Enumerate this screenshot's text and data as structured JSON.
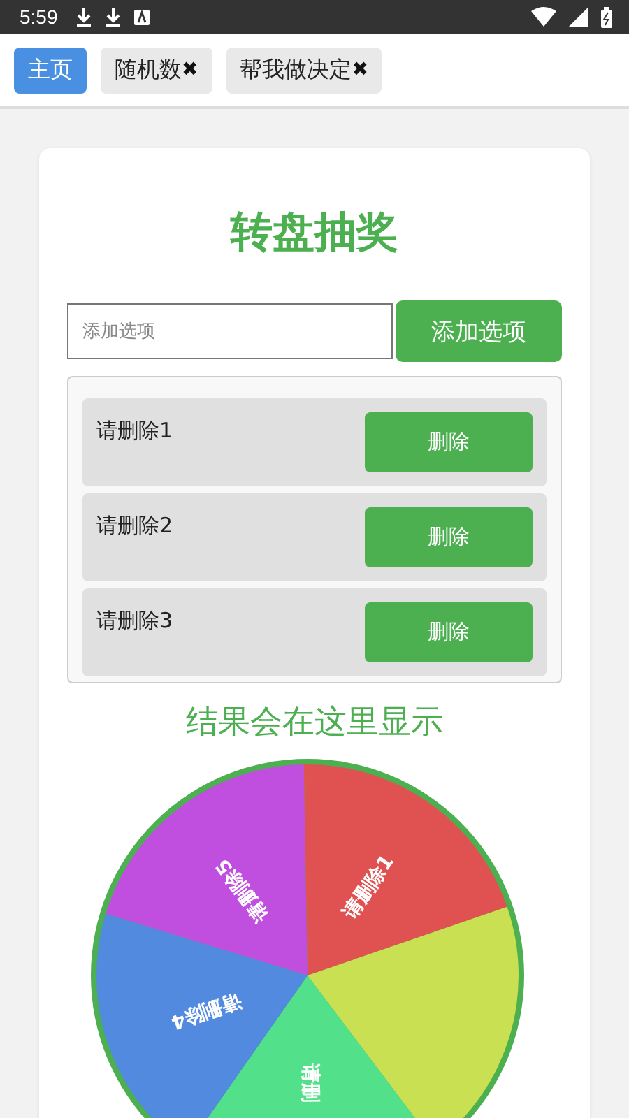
{
  "status_bar": {
    "time": "5:59"
  },
  "tabs": [
    {
      "label": "主页",
      "selected": true
    },
    {
      "label": "随机数",
      "selected": false,
      "close": "✖"
    },
    {
      "label": "帮我做决定",
      "selected": false,
      "close": "✖"
    }
  ],
  "title": "转盘抽奖",
  "add_field": {
    "placeholder": "添加选项"
  },
  "add_button": "添加选项",
  "options": [
    {
      "label": "请删除1",
      "button": "删除"
    },
    {
      "label": "请删除2",
      "button": "删除"
    },
    {
      "label": "请删除3",
      "button": "删除"
    }
  ],
  "result": "结果会在这里显示",
  "wheel": {
    "slices": [
      {
        "color": "#c04fe0",
        "label": "请删除5"
      },
      {
        "color": "#e05252",
        "label": "请删除1"
      },
      {
        "color": "#c8e052"
      },
      {
        "color": "#52e08a",
        "label": "请删"
      },
      {
        "color": "#528ae0",
        "label": "请删除4"
      }
    ]
  }
}
